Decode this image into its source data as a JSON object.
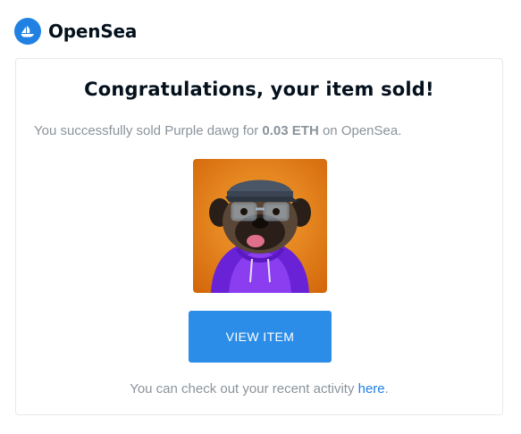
{
  "brand": {
    "name": "OpenSea",
    "logo_icon": "opensea-boat-icon",
    "brand_color": "#2081e2"
  },
  "card": {
    "title": "Congratulations, your item sold!",
    "message": {
      "prefix": "You successfully sold Purple dawg for ",
      "price": "0.03 ETH",
      "suffix": " on OpenSea."
    },
    "image": {
      "icon": "nft-pug-image",
      "background_color": "#f08a1a",
      "hoodie_color": "#7a2fe0"
    },
    "button_label": "VIEW ITEM",
    "button_color": "#2b8de7",
    "footer": {
      "prefix": "You can check out your recent activity ",
      "link_label": "here",
      "suffix": "."
    }
  }
}
